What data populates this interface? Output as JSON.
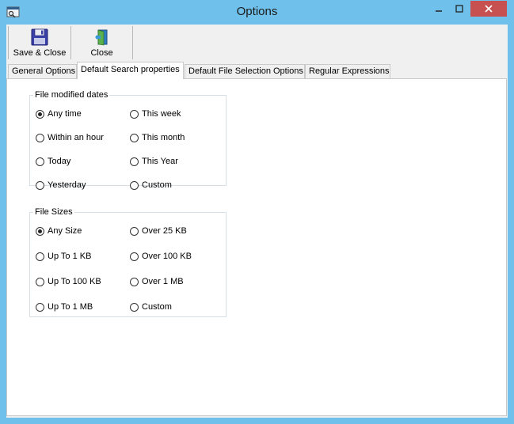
{
  "window": {
    "title": "Options",
    "icons": {
      "app": "app-icon",
      "minimize": "minimize-icon",
      "maximize": "maximize-icon",
      "close": "close-icon"
    }
  },
  "toolbar": {
    "save_close_label": "Save & Close",
    "close_label": "Close",
    "icons": {
      "save": "floppy-disk-icon",
      "close": "exit-door-icon"
    }
  },
  "tabs": [
    {
      "label": "General Options",
      "active": false
    },
    {
      "label": "Default Search properties",
      "active": true
    },
    {
      "label": "Default File Selection Options",
      "active": false
    },
    {
      "label": "Regular Expressions",
      "active": false
    }
  ],
  "file_modified_dates": {
    "legend": "File modified dates",
    "options": [
      {
        "label": "Any time",
        "selected": true
      },
      {
        "label": "This week",
        "selected": false
      },
      {
        "label": "Within an hour",
        "selected": false
      },
      {
        "label": "This month",
        "selected": false
      },
      {
        "label": "Today",
        "selected": false
      },
      {
        "label": "This Year",
        "selected": false
      },
      {
        "label": "Yesterday",
        "selected": false
      },
      {
        "label": "Custom",
        "selected": false
      }
    ]
  },
  "file_sizes": {
    "legend": "File Sizes",
    "options": [
      {
        "label": "Any Size",
        "selected": true
      },
      {
        "label": "Over 25 KB",
        "selected": false
      },
      {
        "label": "Up To 1 KB",
        "selected": false
      },
      {
        "label": "Over 100 KB",
        "selected": false
      },
      {
        "label": "Up To 100 KB",
        "selected": false
      },
      {
        "label": "Over 1 MB",
        "selected": false
      },
      {
        "label": "Up To 1 MB",
        "selected": false
      },
      {
        "label": "Custom",
        "selected": false
      }
    ]
  },
  "colors": {
    "frame": "#6fc1ec",
    "close_button": "#c75050",
    "client": "#f0f0f0",
    "panel": "#ffffff"
  }
}
